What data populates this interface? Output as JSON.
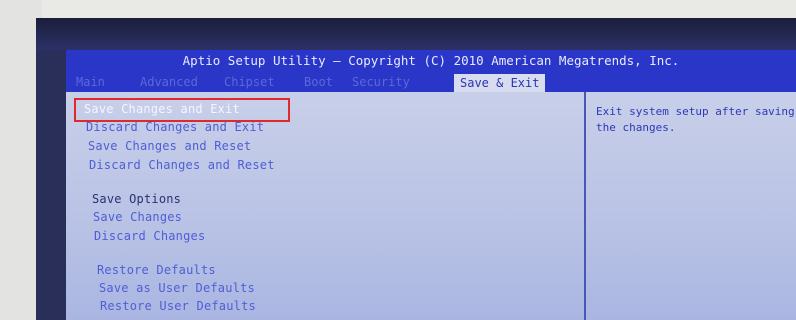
{
  "bios": {
    "title": "Aptio Setup Utility – Copyright (C) 2010 American Megatrends, Inc.",
    "tabs": [
      {
        "label": "Main"
      },
      {
        "label": "Advanced"
      },
      {
        "label": "Chipset"
      },
      {
        "label": "Boot"
      },
      {
        "label": "Security"
      },
      {
        "label": "Save & Exit"
      }
    ],
    "menu": {
      "save_changes_and_exit": "Save Changes and Exit",
      "discard_changes_and_exit": "Discard Changes and Exit",
      "save_changes_and_reset": "Save Changes and Reset",
      "discard_changes_and_reset": "Discard Changes and Reset",
      "save_options_heading": "Save Options",
      "save_changes": "Save Changes",
      "discard_changes": "Discard Changes",
      "restore_defaults": "Restore Defaults",
      "save_as_user_defaults": "Save as User Defaults",
      "restore_user_defaults": "Restore User Defaults"
    },
    "help_text": "Exit system setup after saving\nthe changes."
  },
  "colors": {
    "header_blue": "#2936c8",
    "panel_bg": "#c8cfe9",
    "item_text": "#4f5ed6",
    "selected_text": "#f4f6ff",
    "highlight_box": "#e02929"
  }
}
